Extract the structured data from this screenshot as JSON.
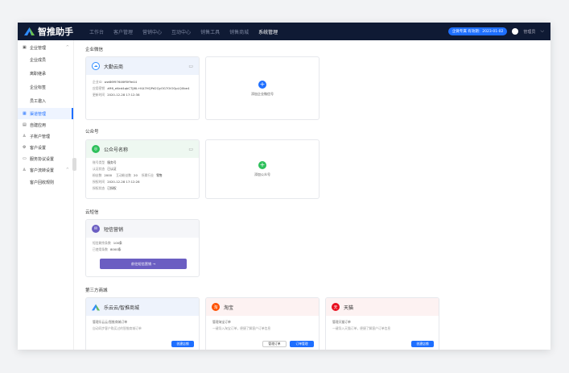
{
  "app": {
    "title": "智推助手"
  },
  "nav": [
    "工作台",
    "客户管理",
    "营销中心",
    "互动中心",
    "销售工具",
    "销售商城",
    "系统管理"
  ],
  "nav_active_index": 6,
  "header": {
    "plan_badge": "企微专属 有效期：2023-01-02",
    "user": "管理员"
  },
  "sidebar": {
    "group1": "企业管理",
    "sub": [
      "企业成员",
      "离职继承",
      "企业标签",
      "员工邀入"
    ],
    "items": [
      "渠道管理",
      "自建应用",
      "子账户管理",
      "客户设置",
      "服务协议设置",
      "客户流转设置"
    ],
    "sub2": [
      "客户回收规则"
    ]
  },
  "sections": {
    "wecom": "企业微信",
    "mp": "公众号",
    "sms": "云短信",
    "mall": "第三方商城"
  },
  "wecom_card": {
    "name": "大勤云商",
    "rows": [
      {
        "k": "企业ID",
        "v": "ww86f97646ff0f9e44"
      },
      {
        "k": "应用密钥",
        "v": "zM6_eKed4qbCTJJ6L+KA7HQPd2QyOG7OiOGpLQ0be4"
      },
      {
        "k": "更新时间",
        "v": "2020-12-28 17:12:38"
      }
    ]
  },
  "add_wecom": "添加企业微信号",
  "mp_card": {
    "name": "公众号名称",
    "rows": [
      {
        "k": "账号类型",
        "v": "服务号"
      },
      {
        "k": "认证状态",
        "v": "已认证"
      },
      {
        "k": "粉丝数",
        "v": "2000",
        "k2": "互动粉丝数",
        "v2": "20",
        "k3": "所属行业",
        "v3": "零售"
      },
      {
        "k": "授权时间",
        "v": "2020-12-28 17:12:28"
      },
      {
        "k": "授权状态",
        "v": "已授权"
      }
    ]
  },
  "add_mp": "添加公众号",
  "sms_card": {
    "name": "短信营销",
    "rows": [
      {
        "k": "短信剩余条数",
        "v": "100条"
      },
      {
        "k": "已使用条数",
        "v": "8000条"
      }
    ],
    "button": "前往短信营销 →"
  },
  "mall": [
    {
      "name": "乐云云/智推商城",
      "title": "管理乐云云/智推商城订单",
      "desc": "自动同步客户购买过的智推商城订单",
      "buttons": [
        "创建店铺"
      ]
    },
    {
      "name": "淘宝",
      "title": "管理淘宝订单",
      "desc": "一键导入淘宝订单，便捷了解客户订单信息",
      "buttons": [
        "管理订单",
        "订单管理"
      ]
    },
    {
      "name": "天猫",
      "title": "管理天猫订单",
      "desc": "一键导入天猫订单，便捷了解客户订单信息",
      "buttons": [
        "创建店铺"
      ]
    }
  ],
  "colors": {
    "accent": "#1e6fff",
    "topbar": "#0f1a34",
    "green": "#2ec05b",
    "purple": "#6b5ec2",
    "taobao": "#ff5000",
    "tmall": "#e8101f"
  }
}
